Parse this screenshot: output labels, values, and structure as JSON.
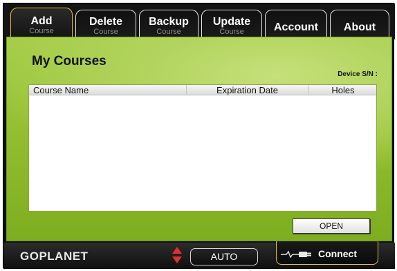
{
  "tabs": [
    {
      "label": "Add",
      "sub": "Course",
      "active": true
    },
    {
      "label": "Delete",
      "sub": "Course"
    },
    {
      "label": "Backup",
      "sub": "Course"
    },
    {
      "label": "Update",
      "sub": "Course"
    },
    {
      "label": "Account"
    },
    {
      "label": "About"
    }
  ],
  "content": {
    "title": "My Courses",
    "device_sn_label": "Device S/N :",
    "table": {
      "columns": [
        "Course Name",
        "Expiration Date",
        "Holes"
      ],
      "rows": []
    },
    "open_button": "OPEN"
  },
  "bottom": {
    "logo": "GOPLANET",
    "mode_button": "AUTO",
    "connect_button": "Connect"
  },
  "colors": {
    "accent_border": "#e2c23a",
    "content_green": "#9cc63c",
    "arrow_red": "#e03030"
  },
  "icons": {
    "mode_arrows": "up-down-arrows-icon",
    "connect": "usb-plug-icon"
  }
}
